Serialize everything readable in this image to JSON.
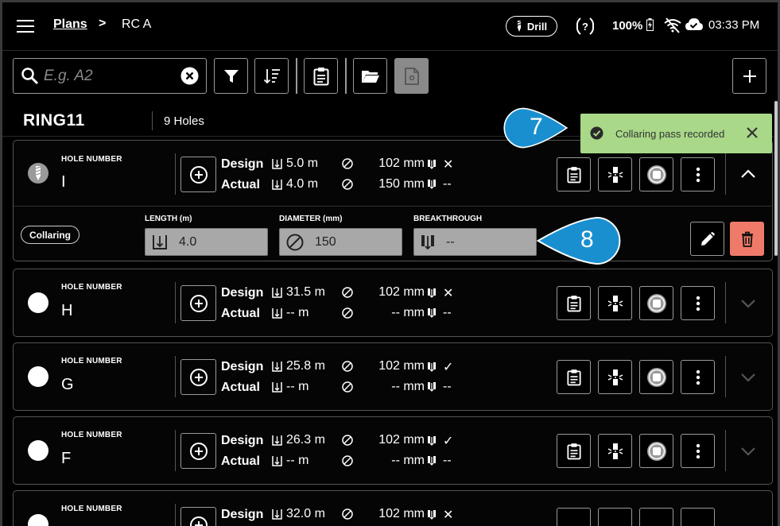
{
  "header": {
    "breadcrumb_root": "Plans",
    "breadcrumb_sep": ">",
    "breadcrumb_current": "RC A",
    "drill_badge": "Drill",
    "battery": "100%",
    "time": "03:33 PM"
  },
  "toolbar": {
    "search_placeholder": "E.g. A2",
    "search_value": ""
  },
  "ring": {
    "name": "RING11",
    "hole_count": "9 Holes"
  },
  "toast": {
    "message": "Collaring pass recorded"
  },
  "callouts": {
    "seven": "7",
    "eight": "8"
  },
  "labels": {
    "hole_number": "HOLE NUMBER",
    "design": "Design",
    "actual": "Actual",
    "collaring": "Collaring",
    "length": "LENGTH (m)",
    "diameter": "DIAMETER (mm)",
    "breakthrough": "BREAKTHROUGH"
  },
  "expanded_fields": {
    "length": "4.0",
    "diameter": "150",
    "breakthrough": "--"
  },
  "holes": [
    {
      "number": "I",
      "design_len": "5.0 m",
      "design_dia": "102 mm",
      "design_bt": "✕",
      "actual_len": "4.0 m",
      "actual_dia": "150 mm",
      "actual_bt": "--"
    },
    {
      "number": "H",
      "design_len": "31.5 m",
      "design_dia": "102 mm",
      "design_bt": "✕",
      "actual_len": "-- m",
      "actual_dia": "-- mm",
      "actual_bt": "--"
    },
    {
      "number": "G",
      "design_len": "25.8 m",
      "design_dia": "102 mm",
      "design_bt": "✓",
      "actual_len": "-- m",
      "actual_dia": "-- mm",
      "actual_bt": "--"
    },
    {
      "number": "F",
      "design_len": "26.3 m",
      "design_dia": "102 mm",
      "design_bt": "✓",
      "actual_len": "-- m",
      "actual_dia": "-- mm",
      "actual_bt": "--"
    },
    {
      "number": "",
      "design_len": "32.0 m",
      "design_dia": "102 mm",
      "design_bt": "✕",
      "actual_len": "",
      "actual_dia": "",
      "actual_bt": ""
    }
  ],
  "colors": {
    "background": "#000000",
    "toast_bg": "#a8d888",
    "callout_blue": "#1a8fd0",
    "delete_red": "#f07a6a",
    "field_grey": "#a8a8a8"
  }
}
